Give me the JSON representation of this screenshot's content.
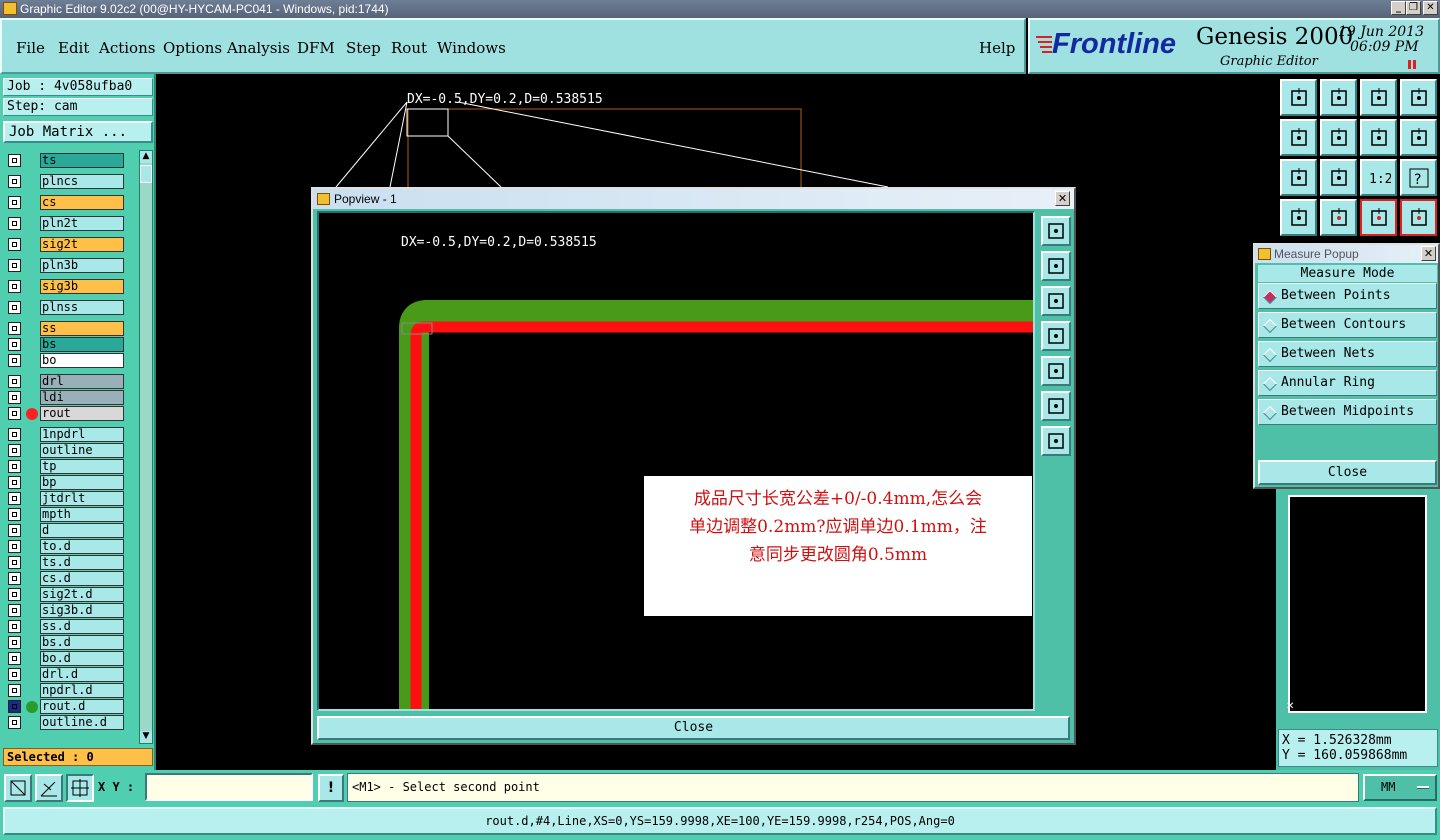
{
  "window": {
    "title": "Graphic Editor 9.02c2 (00@HY-HYCAM-PC041 - Windows, pid:1744)"
  },
  "menu": {
    "file": "File",
    "edit": "Edit",
    "actions": "Actions",
    "options": "Options",
    "analysis": "Analysis",
    "dfm": "DFM",
    "step": "Step",
    "rout": "Rout",
    "windows": "Windows",
    "help": "Help"
  },
  "brand": {
    "logo": "Frontline",
    "product": "Genesis 2000",
    "subtitle": "Graphic Editor",
    "date": "19 Jun 2013",
    "time": "06:09 PM"
  },
  "job": {
    "job_label": "Job : 4v058ufba0",
    "step_label": "Step: cam",
    "matrix_button": "Job Matrix ..."
  },
  "layers": [
    {
      "name": "ts",
      "color": "#2aa898"
    },
    {
      "name": "plncs",
      "color": "#a8e8e8"
    },
    {
      "name": "cs",
      "color": "#ffc04a"
    },
    {
      "name": "pln2t",
      "color": "#a8e8e8"
    },
    {
      "name": "sig2t",
      "color": "#ffc04a"
    },
    {
      "name": "pln3b",
      "color": "#a8e8e8"
    },
    {
      "name": "sig3b",
      "color": "#ffc04a"
    },
    {
      "name": "plnss",
      "color": "#a8e8e8"
    },
    {
      "name": "ss",
      "color": "#ffc04a"
    },
    {
      "name": "bs",
      "color": "#2aa898"
    },
    {
      "name": "bo",
      "color": "#ffffff"
    },
    {
      "name": "drl",
      "color": "#9ab0b8"
    },
    {
      "name": "ldi",
      "color": "#9ab0b8"
    },
    {
      "name": "rout",
      "color": "#d8d8d8",
      "dot": "#ff2020"
    },
    {
      "name": "1npdrl",
      "color": "#a8e8e8"
    },
    {
      "name": "outline",
      "color": "#a8e8e8"
    },
    {
      "name": "tp",
      "color": "#a8e8e8"
    },
    {
      "name": "bp",
      "color": "#a8e8e8"
    },
    {
      "name": "jtdrlt",
      "color": "#a8e8e8"
    },
    {
      "name": "mpth",
      "color": "#a8e8e8"
    },
    {
      "name": "d",
      "color": "#a8e8e8"
    },
    {
      "name": "to.d",
      "color": "#a8e8e8"
    },
    {
      "name": "ts.d",
      "color": "#a8e8e8"
    },
    {
      "name": "cs.d",
      "color": "#a8e8e8"
    },
    {
      "name": "sig2t.d",
      "color": "#a8e8e8"
    },
    {
      "name": "sig3b.d",
      "color": "#a8e8e8"
    },
    {
      "name": "ss.d",
      "color": "#a8e8e8"
    },
    {
      "name": "bs.d",
      "color": "#a8e8e8"
    },
    {
      "name": "bo.d",
      "color": "#a8e8e8"
    },
    {
      "name": "drl.d",
      "color": "#a8e8e8"
    },
    {
      "name": "npdrl.d",
      "color": "#a8e8e8"
    },
    {
      "name": "rout.d",
      "color": "#a8e8e8",
      "dot": "#2a9a2a",
      "active": true
    },
    {
      "name": "outline.d",
      "color": "#a8e8e8"
    }
  ],
  "selected": "Selected : 0",
  "canvas": {
    "measure_text": "DX=-0.5,DY=0.2,D=0.538515"
  },
  "popview": {
    "title": "Popview - 1",
    "measure_text": "DX=-0.5,DY=0.2,D=0.538515",
    "note_line1": "成品尺寸长宽公差+0/-0.4mm,怎么会",
    "note_line2": "单边调整0.2mm?应调单边0.1mm，注",
    "note_line3": "意同步更改圆角0.5mm",
    "close_label": "Close"
  },
  "measure_popup": {
    "title": "Measure Popup",
    "header": "Measure Mode",
    "options": [
      "Between Points",
      "Between Contours",
      "Between Nets",
      "Annular Ring",
      "Between Midpoints"
    ],
    "selected_index": 0,
    "close_label": "Close"
  },
  "coords": {
    "x": "X = 1.526328mm",
    "y": "Y = 160.059868mm"
  },
  "status": {
    "xy_label": "X Y :",
    "xy_value": "",
    "prompt": "<M1> - Select second point",
    "units": "MM"
  },
  "bottom_info": "rout.d,#4,Line,XS=0,YS=159.9998,XE=100,YE=159.9998,r254,POS,Ang=0",
  "colors": {
    "menu_bg": "#9fe0e0",
    "panel_bg": "#4fcfaf",
    "trace_green": "#4a9a1a",
    "trace_red": "#ff1010",
    "note_text": "#d01010"
  }
}
